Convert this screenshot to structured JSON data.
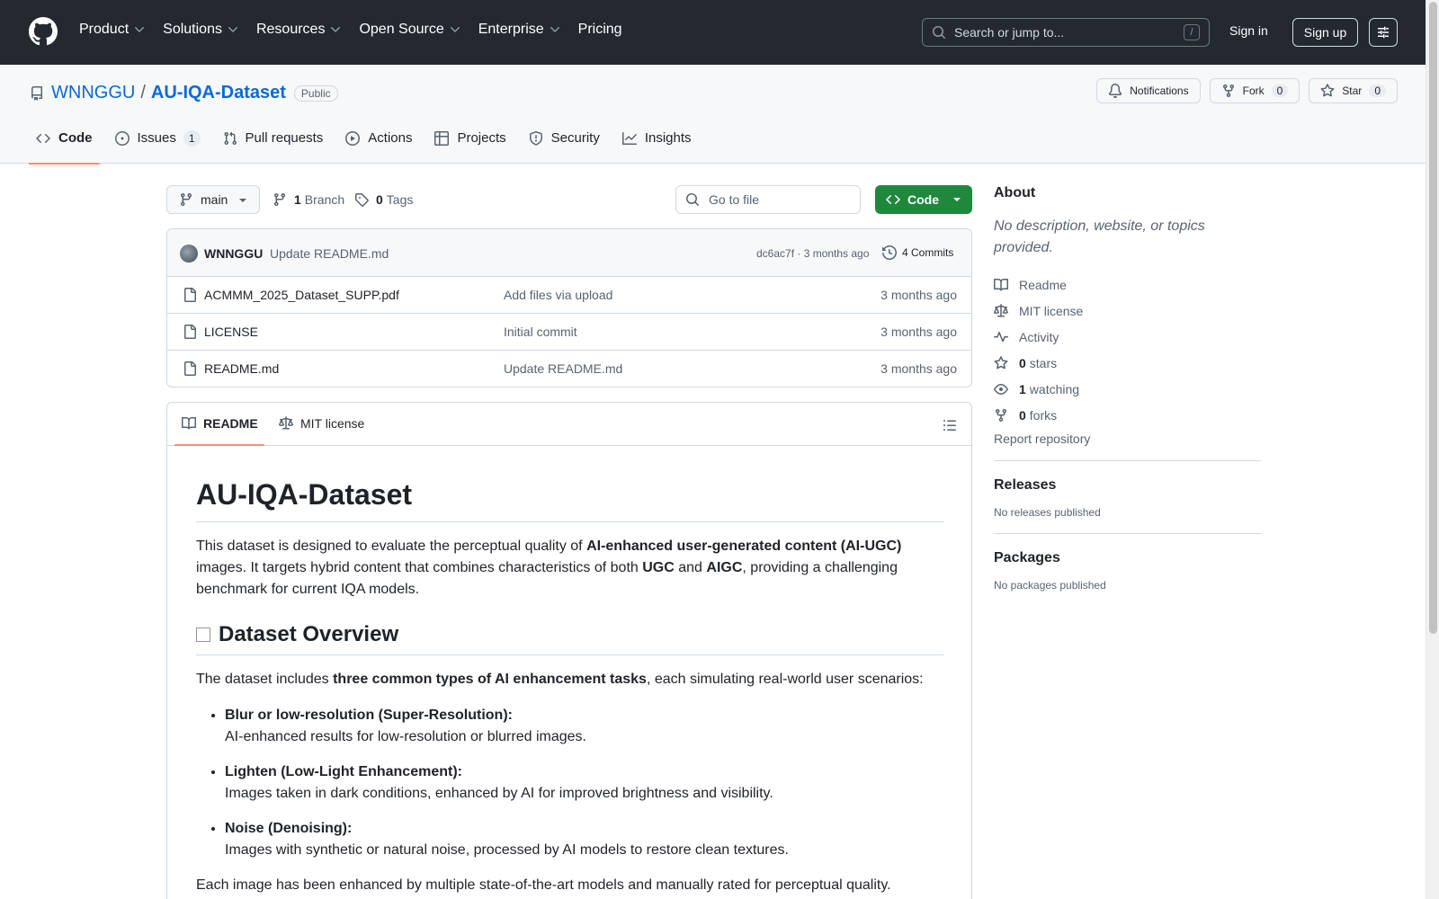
{
  "header": {
    "nav": [
      {
        "label": "Product",
        "dropdown": true
      },
      {
        "label": "Solutions",
        "dropdown": true
      },
      {
        "label": "Resources",
        "dropdown": true
      },
      {
        "label": "Open Source",
        "dropdown": true
      },
      {
        "label": "Enterprise",
        "dropdown": true
      },
      {
        "label": "Pricing",
        "dropdown": false
      }
    ],
    "search_placeholder": "Search or jump to...",
    "search_shortcut": "/",
    "signin": "Sign in",
    "signup": "Sign up"
  },
  "repo": {
    "owner": "WNNGGU",
    "separator": "/",
    "name": "AU-IQA-Dataset",
    "visibility": "Public",
    "notifications": "Notifications",
    "fork_label": "Fork",
    "fork_count": "0",
    "star_label": "Star",
    "star_count": "0"
  },
  "tabs": {
    "code": "Code",
    "issues": "Issues",
    "issues_count": "1",
    "pulls": "Pull requests",
    "actions": "Actions",
    "projects": "Projects",
    "security": "Security",
    "insights": "Insights"
  },
  "toolbar": {
    "branch": "main",
    "branch_count": "1",
    "branch_label": "Branch",
    "tag_count": "0",
    "tag_label": "Tags",
    "goto_placeholder": "Go to file",
    "code_button": "Code"
  },
  "latest_commit": {
    "author": "WNNGGU",
    "message": "Update README.md",
    "meta": "dc6ac7f · 3 months ago",
    "commits": "4 Commits"
  },
  "files": [
    {
      "name": "ACMMM_2025_Dataset_SUPP.pdf",
      "message": "Add files via upload",
      "time": "3 months ago"
    },
    {
      "name": "LICENSE",
      "message": "Initial commit",
      "time": "3 months ago"
    },
    {
      "name": "README.md",
      "message": "Update README.md",
      "time": "3 months ago"
    }
  ],
  "readme_tabs": {
    "readme": "README",
    "license": "MIT license"
  },
  "readme": {
    "title": "AU-IQA-Dataset",
    "intro_1": "This dataset is designed to evaluate the perceptual quality of ",
    "intro_bold_1": "AI-enhanced user-generated content (AI-UGC)",
    "intro_2": " images. It targets hybrid content that combines characteristics of both ",
    "intro_bold_2": "UGC",
    "intro_3": " and ",
    "intro_bold_3": "AIGC",
    "intro_4": ", providing a challenging benchmark for current IQA models.",
    "overview_heading": "Dataset Overview",
    "overview_1": "The dataset includes ",
    "overview_bold": "three common types of AI enhancement tasks",
    "overview_2": ", each simulating real-world user scenarios:",
    "tasks": [
      {
        "title": "Blur or low-resolution (Super-Resolution):",
        "desc": "AI-enhanced results for low-resolution or blurred images."
      },
      {
        "title": "Lighten (Low-Light Enhancement):",
        "desc": "Images taken in dark conditions, enhanced by AI for improved brightness and visibility."
      },
      {
        "title": "Noise (Denoising):",
        "desc": "Images with synthetic or natural noise, processed by AI models to restore clean textures."
      }
    ],
    "closing": "Each image has been enhanced by multiple state-of-the-art models and manually rated for perceptual quality."
  },
  "about": {
    "heading": "About",
    "description": "No description, website, or topics provided.",
    "readme": "Readme",
    "license": "MIT license",
    "activity": "Activity",
    "stars_count": "0",
    "stars_label": "stars",
    "watching_count": "1",
    "watching_label": "watching",
    "forks_count": "0",
    "forks_label": "forks",
    "report": "Report repository"
  },
  "releases": {
    "heading": "Releases",
    "text": "No releases published"
  },
  "packages": {
    "heading": "Packages",
    "text": "No packages published"
  }
}
